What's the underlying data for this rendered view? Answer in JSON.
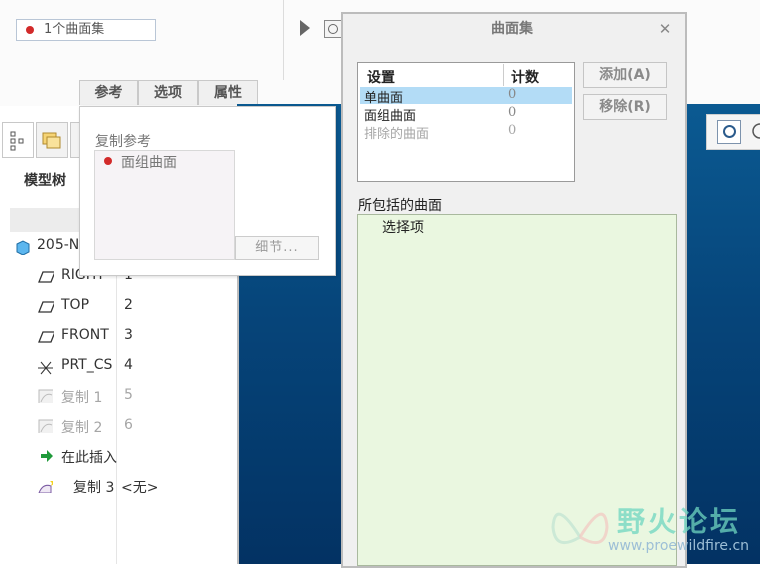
{
  "ribbon": {
    "surfset_field": "1个曲面集",
    "tabs": [
      "参考",
      "选项",
      "属性"
    ]
  },
  "ref_popup": {
    "copy_ref_label": "复制参考",
    "ref_item": "面组曲面",
    "details_button": "细节..."
  },
  "model_tree": {
    "label": "模型树",
    "items": [
      {
        "name": "205-N",
        "num": ""
      },
      {
        "name": "RIGHT",
        "num": "1"
      },
      {
        "name": "TOP",
        "num": "2"
      },
      {
        "name": "FRONT",
        "num": "3"
      },
      {
        "name": "PRT_CS",
        "num": "4"
      },
      {
        "name": "复制 1",
        "num": "5"
      },
      {
        "name": "复制 2",
        "num": "6"
      },
      {
        "name": "在此插入",
        "num": ""
      },
      {
        "name": "复制 3",
        "num": "<无>"
      }
    ]
  },
  "dialog": {
    "title": "曲面集",
    "table_headers": {
      "setting": "设置",
      "count": "计数"
    },
    "rows": [
      {
        "label": "单曲面",
        "count": "0"
      },
      {
        "label": "面组曲面",
        "count": "0"
      },
      {
        "label": "排除的曲面",
        "count": "0"
      }
    ],
    "add_button": "添加(A)",
    "remove_button": "移除(R)",
    "included_label": "所包括的曲面",
    "select_items": "选择项"
  },
  "watermark": {
    "title": "野火论坛",
    "url": "www.proewildfire.cn"
  },
  "colors": {
    "graphics_bg": "#06457a",
    "selected_row": "#b3dcf6",
    "included_box": "#eaf7e0",
    "red_dot": "#d22a2a"
  }
}
